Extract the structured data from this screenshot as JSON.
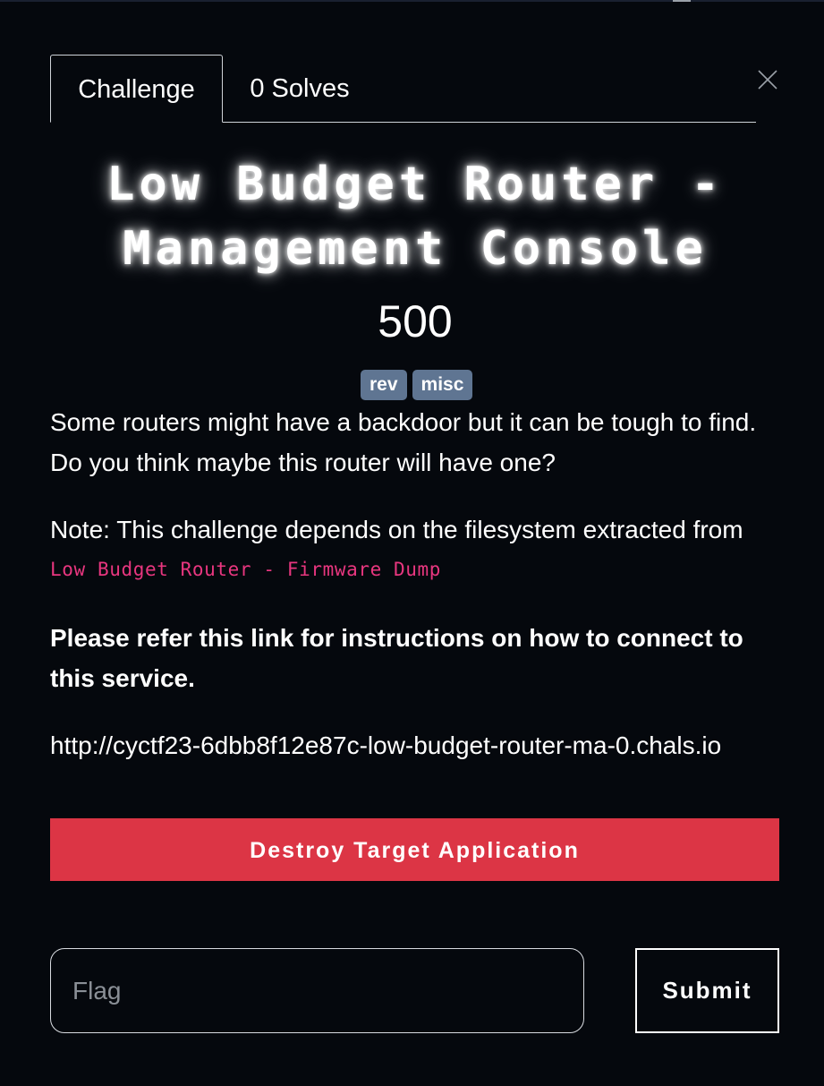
{
  "tabs": [
    {
      "label": "Challenge",
      "active": true
    },
    {
      "label": "0 Solves",
      "active": false
    }
  ],
  "close_icon": "close-icon",
  "challenge": {
    "title_line1": "Low Budget Router -",
    "title_line2": "Management Console",
    "points": "500",
    "tags": [
      "rev",
      "misc"
    ],
    "description": {
      "p1": "Some routers might have a backdoor but it can be tough to find. Do you think maybe this router will have one?",
      "p2": "Note: This challenge depends on the filesystem extracted from",
      "p2_code": "Low Budget Router - Firmware Dump",
      "p3": "Please refer this link for instructions on how to connect to this service.",
      "p4": "http://cyctf23-6dbb8f12e87c-low-budget-router-ma-0.chals.io"
    }
  },
  "destroy_button": "Destroy Target Application",
  "flag": {
    "placeholder": "Flag",
    "value": ""
  },
  "submit_button": "Submit",
  "colors": {
    "background": "#05080d",
    "tag": "#5f7592",
    "destroy": "#dc3545",
    "code": "#e8367f"
  }
}
